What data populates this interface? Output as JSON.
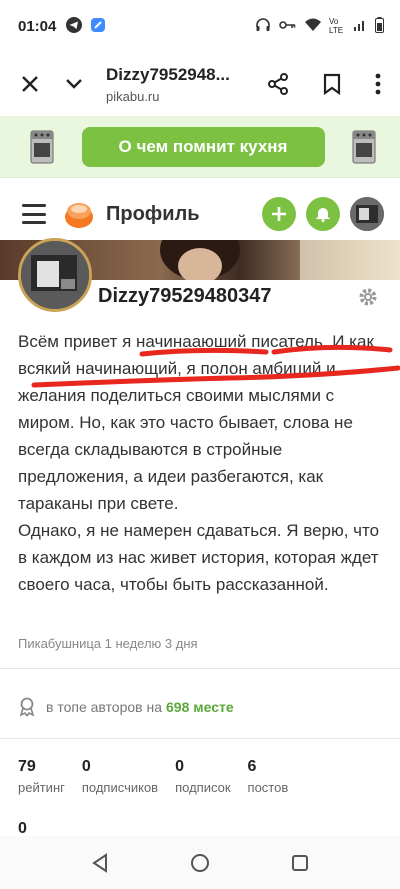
{
  "status": {
    "time": "01:04",
    "right_text": "Vo LTE"
  },
  "browser": {
    "title": "Dizzy7952948...",
    "domain": "pikabu.ru"
  },
  "promo": {
    "button_label": "О чем помнит кухня"
  },
  "header": {
    "title": "Профиль"
  },
  "profile": {
    "username": "Dizzy79529480347",
    "bio_paragraph1": "Всём привет я начинааюший писатель. И как всякий начинающий, я полон амбиций и желания поделиться своими мыслями с миром. Но, как это часто бывает, слова не всегда складываются в стройные предложения, а идеи разбегаются, как тараканы при свете.",
    "bio_paragraph2": "Однако, я не намерен сдаваться. Я верю, что в каждом из нас живет история, которая ждет своего часа, чтобы быть рассказанной.",
    "joined": "Пикабушница 1 неделю 3 дня",
    "top_prefix": "в топе авторов на",
    "top_rank": "698 месте"
  },
  "stats": [
    {
      "num": "79",
      "label": "рейтинг"
    },
    {
      "num": "0",
      "label": "подписчиков"
    },
    {
      "num": "0",
      "label": "подписок"
    },
    {
      "num": "6",
      "label": "постов"
    }
  ],
  "stats_extra": "0",
  "colors": {
    "accent": "#7cc142",
    "promo_bg": "#e9f7df",
    "rank_green": "#5aa83a",
    "scribble_red": "#e8281e"
  }
}
